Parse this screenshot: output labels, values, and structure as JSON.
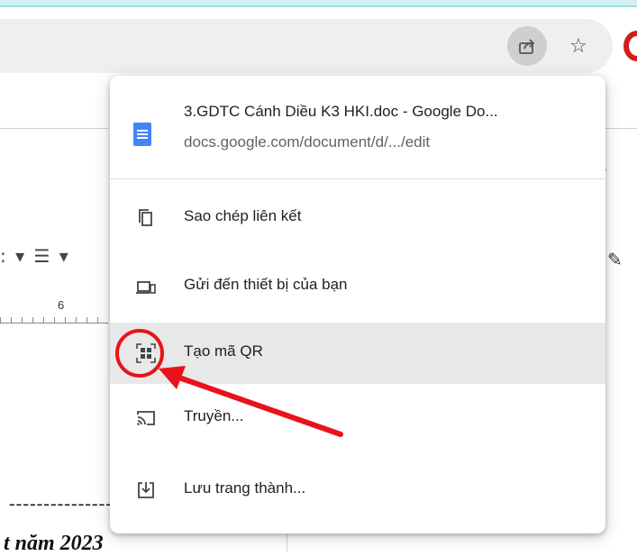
{
  "browser": {
    "share_icon": "share-icon",
    "bookmark_icon": "star-icon",
    "extension_icon": "opera-extension-icon"
  },
  "background_doc": {
    "ruler_number": "6",
    "dashes": "-------------------",
    "year_text": "t    năm 2023"
  },
  "share_menu": {
    "header": {
      "title": "3.GDTC Cánh Diều K3 HKI.doc - Google Do...",
      "url": "docs.google.com/document/d/.../edit",
      "icon": "google-docs-icon"
    },
    "items": [
      {
        "label": "Sao chép liên kết",
        "icon": "copy-icon"
      },
      {
        "label": "Gửi đến thiết bị của bạn",
        "icon": "send-to-device-icon"
      },
      {
        "label": "Tạo mã QR",
        "icon": "qr-code-icon",
        "highlighted": true
      },
      {
        "label": "Truyền...",
        "icon": "cast-icon"
      },
      {
        "label": "Lưu trang thành...",
        "icon": "save-page-icon"
      }
    ]
  },
  "colors": {
    "highlight": "#e8e8e8",
    "annotation_red": "#e8121c",
    "docs_blue": "#4285f4"
  }
}
